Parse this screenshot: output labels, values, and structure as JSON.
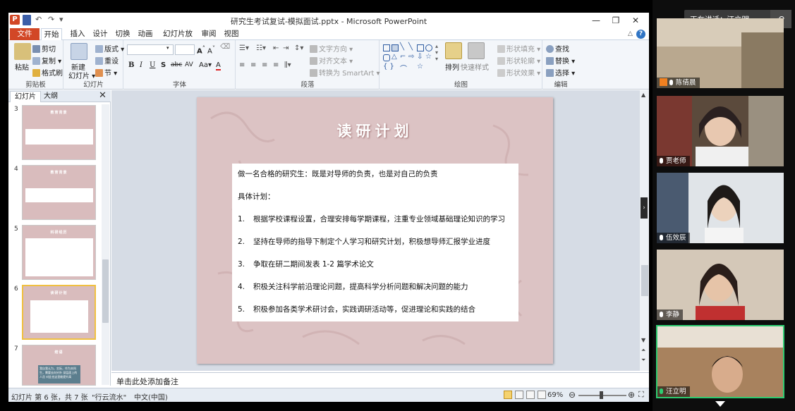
{
  "window": {
    "title": "研究生考试复试-模拟面试.pptx - Microsoft PowerPoint",
    "app_icon_letter": "P"
  },
  "ribbon_tabs": [
    "文件",
    "开始",
    "插入",
    "设计",
    "切换",
    "动画",
    "幻灯片放映",
    "审阅",
    "视图"
  ],
  "ribbon": {
    "clipboard": {
      "label": "剪贴板",
      "paste": "粘贴",
      "cut": "剪切",
      "copy": "复制",
      "format_painter": "格式刷"
    },
    "slides": {
      "label": "幻灯片",
      "new_slide_line1": "新建",
      "new_slide_line2": "幻灯片",
      "layout": "版式",
      "reset": "重设",
      "section": "节"
    },
    "font": {
      "label": "字体",
      "bold": "B",
      "italic": "I",
      "underline": "U",
      "shadow": "S",
      "strike": "abc",
      "spacing": "AV",
      "case": "Aa",
      "color": "A"
    },
    "paragraph": {
      "label": "段落",
      "text_direction": "文字方向",
      "align_text": "对齐文本",
      "smartart": "转换为 SmartArt"
    },
    "drawing": {
      "label": "绘图",
      "arrange": "排列",
      "quick_styles": "快速样式",
      "shape_fill": "形状填充",
      "shape_outline": "形状轮廓",
      "shape_effects": "形状效果"
    },
    "editing": {
      "label": "编辑",
      "find": "查找",
      "replace": "替换",
      "select": "选择"
    }
  },
  "left_pane": {
    "tabs": [
      "幻灯片",
      "大纲"
    ],
    "thumbnails": [
      {
        "num": "3",
        "title": "教育背景"
      },
      {
        "num": "4",
        "title": "教育背景"
      },
      {
        "num": "5",
        "title": "科研经历"
      },
      {
        "num": "6",
        "title": "读研计划"
      },
      {
        "num": "7",
        "title": "结语",
        "caption": "我自我认为，实际，作为本科生，需要去向另外 深层面上的人员 对此也这里能提升高"
      }
    ],
    "selected": "6"
  },
  "slide": {
    "title": "读研计划",
    "heading": "做一名合格的研究生：既是对导师的负责，也是对自己的负责",
    "plan_label": "具体计划：",
    "items": [
      {
        "num": "1.",
        "text": "根据学校课程设置，合理安排每学期课程，注重专业领域基础理论知识的学习"
      },
      {
        "num": "2.",
        "text": "坚持在导师的指导下制定个人学习和研究计划，积极想导师汇报学业进度"
      },
      {
        "num": "3.",
        "text": "争取在研二期间发表 1-2 篇学术论文"
      },
      {
        "num": "4.",
        "text": "积极关注科学前沿理论问题，提高科学分析问题和解决问题的能力"
      },
      {
        "num": "5.",
        "text": "积极参加各类学术研讨会，实践调研活动等，促进理论和实践的结合"
      }
    ]
  },
  "notes_placeholder": "单击此处添加备注",
  "status": {
    "slide_info": "幻灯片 第 6 张，共 7 张",
    "theme": "\"行云流水\"",
    "language": "中文(中国)",
    "zoom": "69%"
  },
  "meeting": {
    "sharing_banner": "正在讲话：汪立明",
    "participants": [
      "陈倩晨",
      "贾老师",
      "伍效辰",
      "李静",
      "汪立明"
    ]
  },
  "colors": {
    "ppt_accent": "#d24726",
    "slide_bg": "#dcc3c4",
    "active_speaker": "#2ecc71"
  }
}
